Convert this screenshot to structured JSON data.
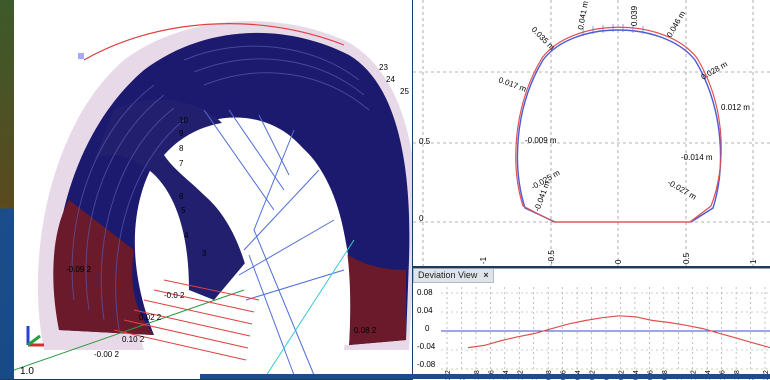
{
  "view3d": {
    "coord_label": "1.0",
    "ring_labels_right": [
      "23",
      "24",
      "25"
    ],
    "ring_labels_inner": [
      "10",
      "9",
      "8",
      "7",
      "6",
      "5",
      "4",
      "3"
    ],
    "bottom_labels": [
      "-0.09 2",
      "-0.0 2",
      "0.02 2",
      "0.08 2",
      "0.10 2",
      "-0.00 2"
    ]
  },
  "section_view": {
    "deviation_labels": [
      {
        "text": "0.041 m"
      },
      {
        "text": "0.039"
      },
      {
        "text": "0.046 m"
      },
      {
        "text": "0.035 m"
      },
      {
        "text": "0.028 m"
      },
      {
        "text": "0.017 m"
      },
      {
        "text": "0.012 m"
      },
      {
        "text": "-0.009 m"
      },
      {
        "text": "-0.014 m"
      },
      {
        "text": "-0.025 m"
      },
      {
        "text": "-0.027 m"
      },
      {
        "text": "-0.041 m"
      }
    ],
    "y_ticks": [
      "0.5",
      "0"
    ],
    "x_ticks": [
      "-1",
      "-0.5",
      "0",
      "0.5",
      "1"
    ]
  },
  "deviation_view": {
    "tab_label": "Deviation View",
    "close_label": "×",
    "y_ticks": [
      "0.08",
      "0.04",
      "0",
      "-0.04",
      "-0.08"
    ],
    "x_ticks": [
      "2.2",
      "2",
      "1.8",
      "1.6",
      "1.4",
      "1.2",
      "1",
      "0.8",
      "0.6",
      "0.4",
      "0.2",
      "0",
      "0.2",
      "0.4",
      "0.6",
      "0.8",
      "1",
      "1.2",
      "1.4",
      "1.6",
      "1.8",
      "2",
      "2.2"
    ],
    "profile": [
      -0.035,
      -0.03,
      -0.02,
      -0.012,
      -0.005,
      0.005,
      0.015,
      0.022,
      0.028,
      0.032,
      0.03,
      0.022,
      0.018,
      0.012,
      0.005,
      -0.005,
      -0.015,
      -0.025,
      -0.035
    ]
  }
}
